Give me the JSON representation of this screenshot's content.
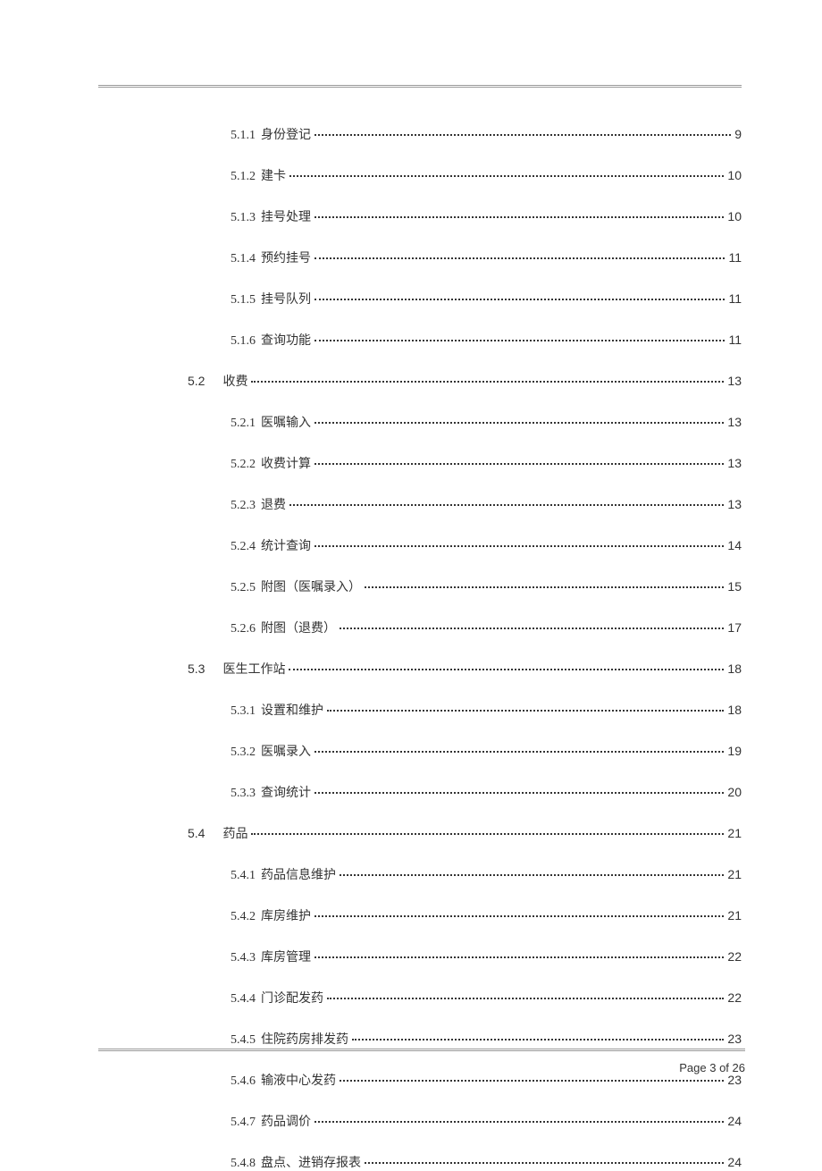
{
  "toc": [
    {
      "level": 3,
      "num": "5.1.1",
      "title": "身份登记",
      "page": "9"
    },
    {
      "level": 3,
      "num": "5.1.2",
      "title": "建卡",
      "page": "10"
    },
    {
      "level": 3,
      "num": "5.1.3",
      "title": "挂号处理",
      "page": "10"
    },
    {
      "level": 3,
      "num": "5.1.4",
      "title": "预约挂号",
      "page": "11"
    },
    {
      "level": 3,
      "num": "5.1.5",
      "title": "挂号队列",
      "page": "11"
    },
    {
      "level": 3,
      "num": "5.1.6",
      "title": "查询功能",
      "page": "11"
    },
    {
      "level": 2,
      "num": "5.2",
      "title": "收费",
      "page": "13"
    },
    {
      "level": 3,
      "num": "5.2.1",
      "title": "医嘱输入",
      "page": "13"
    },
    {
      "level": 3,
      "num": "5.2.2",
      "title": "收费计算",
      "page": "13"
    },
    {
      "level": 3,
      "num": "5.2.3",
      "title": "退费",
      "page": "13"
    },
    {
      "level": 3,
      "num": "5.2.4",
      "title": "统计查询",
      "page": "14"
    },
    {
      "level": 3,
      "num": "5.2.5",
      "title": "附图（医嘱录入）",
      "page": "15"
    },
    {
      "level": 3,
      "num": "5.2.6",
      "title": "附图（退费）",
      "page": "17"
    },
    {
      "level": 2,
      "num": "5.3",
      "title": "医生工作站",
      "page": "18"
    },
    {
      "level": 3,
      "num": "5.3.1",
      "title": "设置和维护",
      "page": "18"
    },
    {
      "level": 3,
      "num": "5.3.2",
      "title": "医嘱录入",
      "page": "19"
    },
    {
      "level": 3,
      "num": "5.3.3",
      "title": "查询统计",
      "page": "20"
    },
    {
      "level": 2,
      "num": "5.4",
      "title": "药品",
      "page": "21"
    },
    {
      "level": 3,
      "num": "5.4.1",
      "title": "药品信息维护",
      "page": "21"
    },
    {
      "level": 3,
      "num": "5.4.2",
      "title": "库房维护",
      "page": "21"
    },
    {
      "level": 3,
      "num": "5.4.3",
      "title": "库房管理",
      "page": "22"
    },
    {
      "level": 3,
      "num": "5.4.4",
      "title": "门诊配发药",
      "page": "22"
    },
    {
      "level": 3,
      "num": "5.4.5",
      "title": "住院药房排发药",
      "page": "23"
    },
    {
      "level": 3,
      "num": "5.4.6",
      "title": "输液中心发药",
      "page": "23"
    },
    {
      "level": 3,
      "num": "5.4.7",
      "title": "药品调价",
      "page": "24"
    },
    {
      "level": 3,
      "num": "5.4.8",
      "title": "盘点、进销存报表",
      "page": "24"
    }
  ],
  "footer": {
    "pageNumber": "Page 3 of 26"
  }
}
